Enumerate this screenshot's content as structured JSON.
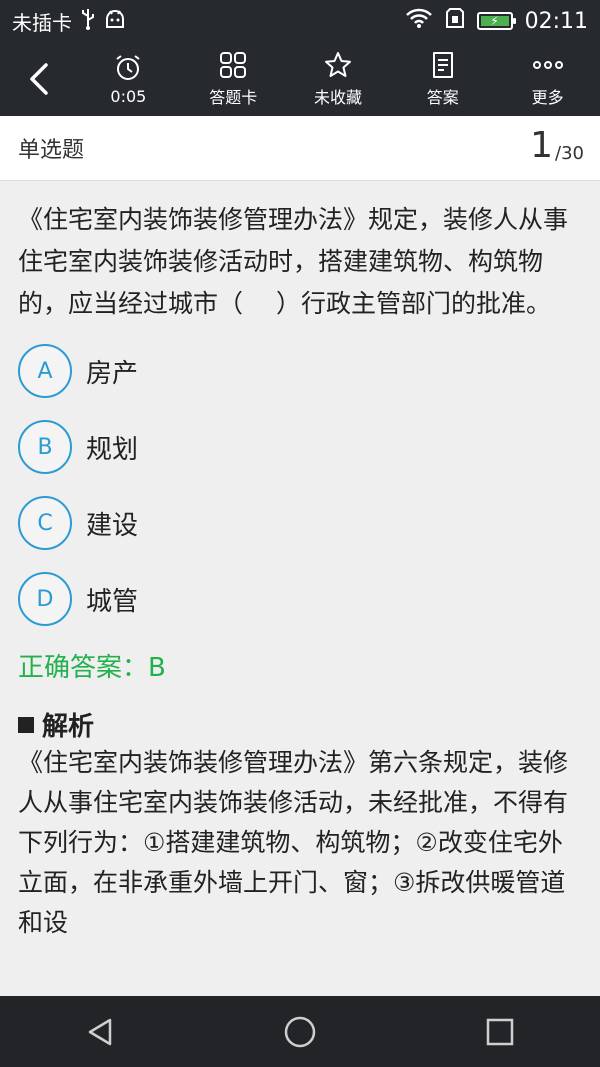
{
  "status": {
    "carrier": "未插卡",
    "time": "02:11"
  },
  "toolbar": {
    "timer": "0:05",
    "answer_card": "答题卡",
    "favorite": "未收藏",
    "answer": "答案",
    "more": "更多"
  },
  "header": {
    "type": "单选题",
    "current": "1",
    "total": "/30"
  },
  "question": {
    "text": "《住宅室内装饰装修管理办法》规定，装修人从事住宅室内装饰装修活动时，搭建建筑物、构筑物的，应当经过城市（　 ）行政主管部门的批准。",
    "options": [
      {
        "letter": "A",
        "text": "房产"
      },
      {
        "letter": "B",
        "text": "规划"
      },
      {
        "letter": "C",
        "text": "建设"
      },
      {
        "letter": "D",
        "text": "城管"
      }
    ],
    "correct": "正确答案：B"
  },
  "explanation": {
    "title": "解析",
    "text": "《住宅室内装饰装修管理办法》第六条规定，装修人从事住宅室内装饰装修活动，未经批准，不得有下列行为：①搭建建筑物、构筑物；②改变住宅外立面，在非承重外墙上开门、窗；③拆改供暖管道和设"
  },
  "colors": {
    "bar_bg": "#262a2e",
    "accent_blue": "#2b9bd3",
    "correct_green": "#23b14d"
  }
}
